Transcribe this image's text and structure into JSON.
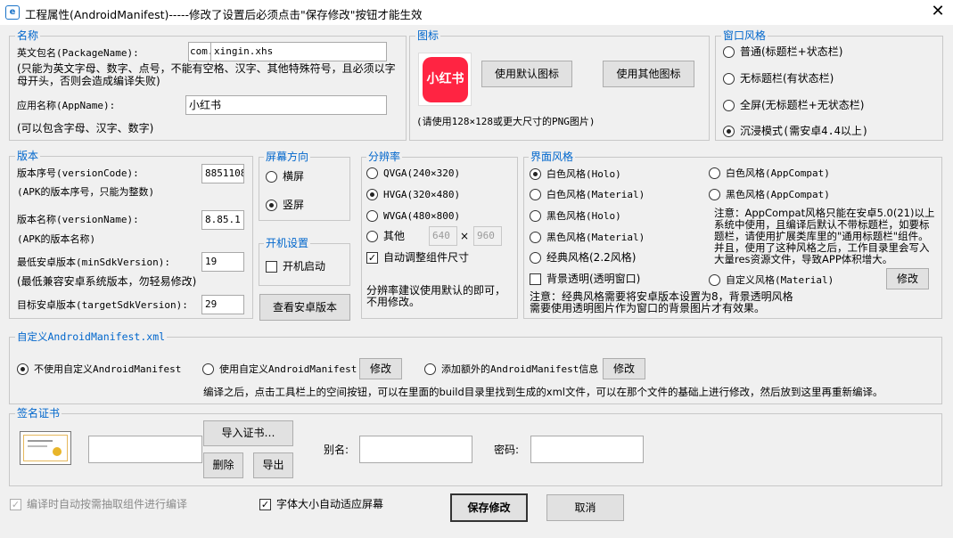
{
  "window": {
    "title": "工程属性(AndroidManifest)-----修改了设置后必须点击\"保存修改\"按钮才能生效",
    "close_glyph": "✕"
  },
  "name_group": {
    "label": "名称",
    "package_label": "英文包名(PackageName):",
    "package_prefix": "com.",
    "package_value": "xingin.xhs",
    "package_hint": "(只能为英文字母、数字、点号，不能有空格、汉字、其他特殊符号，且必须以字母开头，否则会造成编译失败)",
    "app_name_label": "应用名称(AppName):",
    "app_name_value": "小红书",
    "app_name_hint": "(可以包含字母、汉字、数字)"
  },
  "icon_group": {
    "label": "图标",
    "icon_text": "小红书",
    "icon_color": "#ff2442",
    "default_button": "使用默认图标",
    "other_button": "使用其他图标",
    "hint": "(请使用128×128或更大尺寸的PNG图片)"
  },
  "window_style": {
    "label": "窗口风格",
    "options": [
      {
        "text": "普通(标题栏+状态栏)",
        "selected": false
      },
      {
        "text": "无标题栏(有状态栏)",
        "selected": false
      },
      {
        "text": "全屏(无标题栏+无状态栏)",
        "selected": false
      },
      {
        "text": "沉浸模式(需安卓4.4以上)",
        "selected": true
      }
    ]
  },
  "version_group": {
    "label": "版本",
    "version_code_label": "版本序号(versionCode):",
    "version_code_value": "8851108",
    "version_code_hint": "(APK的版本序号，只能为整数)",
    "version_name_label": "版本名称(versionName):",
    "version_name_value": "8.85.1",
    "version_name_hint": "(APK的版本名称)",
    "min_sdk_label": "最低安卓版本(minSdkVersion):",
    "min_sdk_value": "19",
    "min_sdk_hint": "(最低兼容安卓系统版本，勿轻易修改)",
    "target_sdk_label": "目标安卓版本(targetSdkVersion):",
    "target_sdk_value": "29"
  },
  "orientation_group": {
    "label": "屏幕方向",
    "options": [
      {
        "text": "横屏",
        "selected": false
      },
      {
        "text": "竖屏",
        "selected": true
      }
    ]
  },
  "boot_group": {
    "label": "开机设置",
    "autostart_label": "开机启动",
    "autostart_checked": false
  },
  "view_android_version_button": "查看安卓版本",
  "resolution_group": {
    "label": "分辨率",
    "options": [
      {
        "text": "QVGA(240×320)",
        "selected": false
      },
      {
        "text": "HVGA(320×480)",
        "selected": true
      },
      {
        "text": "WVGA(480×800)",
        "selected": false
      }
    ],
    "other_label": "其他",
    "other_width": "640",
    "times": "×",
    "other_height": "960",
    "auto_adjust_label": "自动调整组件尺寸",
    "auto_adjust_checked": true,
    "hint": "分辨率建议使用默认的即可，不用修改。"
  },
  "ui_style_group": {
    "label": "界面风格",
    "left_options": [
      {
        "text": "白色风格(Holo)",
        "selected": true
      },
      {
        "text": "白色风格(Material)",
        "selected": false
      },
      {
        "text": "黑色风格(Holo)",
        "selected": false
      },
      {
        "text": "黑色风格(Material)",
        "selected": false
      },
      {
        "text": "经典风格(2.2风格)",
        "selected": false
      }
    ],
    "right_options": [
      {
        "text": "白色风格(AppCompat)",
        "selected": false
      },
      {
        "text": "黑色风格(AppCompat)",
        "selected": false
      }
    ],
    "note": "注意：AppCompat风格只能在安卓5.0(21)以上系统中使用，且编译后默认不带标题栏，如要标题栏，请使用扩展类库里的\"通用标题栏\"组件。并且，使用了这种风格之后，工作目录里会写入大量res资源文件，导致APP体积增大。",
    "transparent_bg_label": "背景透明(透明窗口)",
    "transparent_bg_checked": false,
    "custom_style_label": "自定义风格(Material)",
    "custom_style_selected": false,
    "modify_button": "修改",
    "bottom_note": "注意：经典风格需要将安卓版本设置为8，背景透明风格需要使用透明图片作为窗口的背景图片才有效果。"
  },
  "manifest_group": {
    "label": "自定义AndroidManifest.xml",
    "option_none": "不使用自定义AndroidManifest",
    "option_custom": "使用自定义AndroidManifest",
    "option_extra": "添加额外的AndroidManifest信息",
    "selected": "none",
    "modify_button_1": "修改",
    "modify_button_2": "修改",
    "hint": "编译之后，点击工具栏上的空间按钮，可以在里面的build目录里找到生成的xml文件，可以在那个文件的基础上进行修改，然后放到这里再重新编译。"
  },
  "cert_group": {
    "label": "签名证书",
    "cert_path_value": "",
    "import_button": "导入证书…",
    "delete_button": "删除",
    "export_button": "导出",
    "alias_label": "别名:",
    "alias_value": "",
    "password_label": "密码:",
    "password_value": ""
  },
  "footer": {
    "auto_extract_label": "编译时自动按需抽取组件进行编译",
    "auto_extract_checked": true,
    "auto_extract_enabled": false,
    "font_fit_label": "字体大小自动适应屏幕",
    "font_fit_checked": true,
    "save_button": "保存修改",
    "cancel_button": "取消"
  }
}
